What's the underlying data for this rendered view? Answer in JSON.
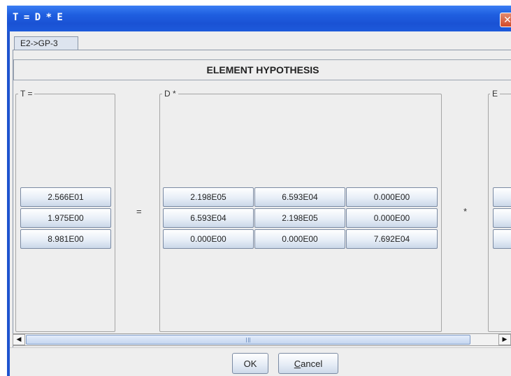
{
  "window": {
    "title": "T = D * E",
    "close_glyph": "✕"
  },
  "tabs": [
    {
      "label": "E2->GP-3"
    }
  ],
  "panel": {
    "header": "ELEMENT HYPOTHESIS"
  },
  "groups": {
    "t": {
      "label": "T =",
      "values": [
        "2.566E01",
        "1.975E00",
        "8.981E00"
      ]
    },
    "d": {
      "label": "D *",
      "rows": [
        [
          "2.198E05",
          "6.593E04",
          "0.000E00"
        ],
        [
          "6.593E04",
          "2.198E05",
          "0.000E00"
        ],
        [
          "0.000E00",
          "0.000E00",
          "7.692E04"
        ]
      ]
    },
    "e": {
      "label": "E"
    }
  },
  "operators": {
    "equals": "=",
    "times": "*"
  },
  "scrollbar": {
    "left_arrow": "◀",
    "right_arrow": "▶"
  },
  "buttons": {
    "ok": "OK",
    "cancel_mnemonic": "C",
    "cancel_rest": "ancel"
  },
  "colors": {
    "titlebar": "#1f5fe0",
    "close": "#d14a28",
    "background": "#eeeeee"
  },
  "icons": {
    "close": "close-icon",
    "scroll_left": "arrow-left-icon",
    "scroll_right": "arrow-right-icon"
  }
}
